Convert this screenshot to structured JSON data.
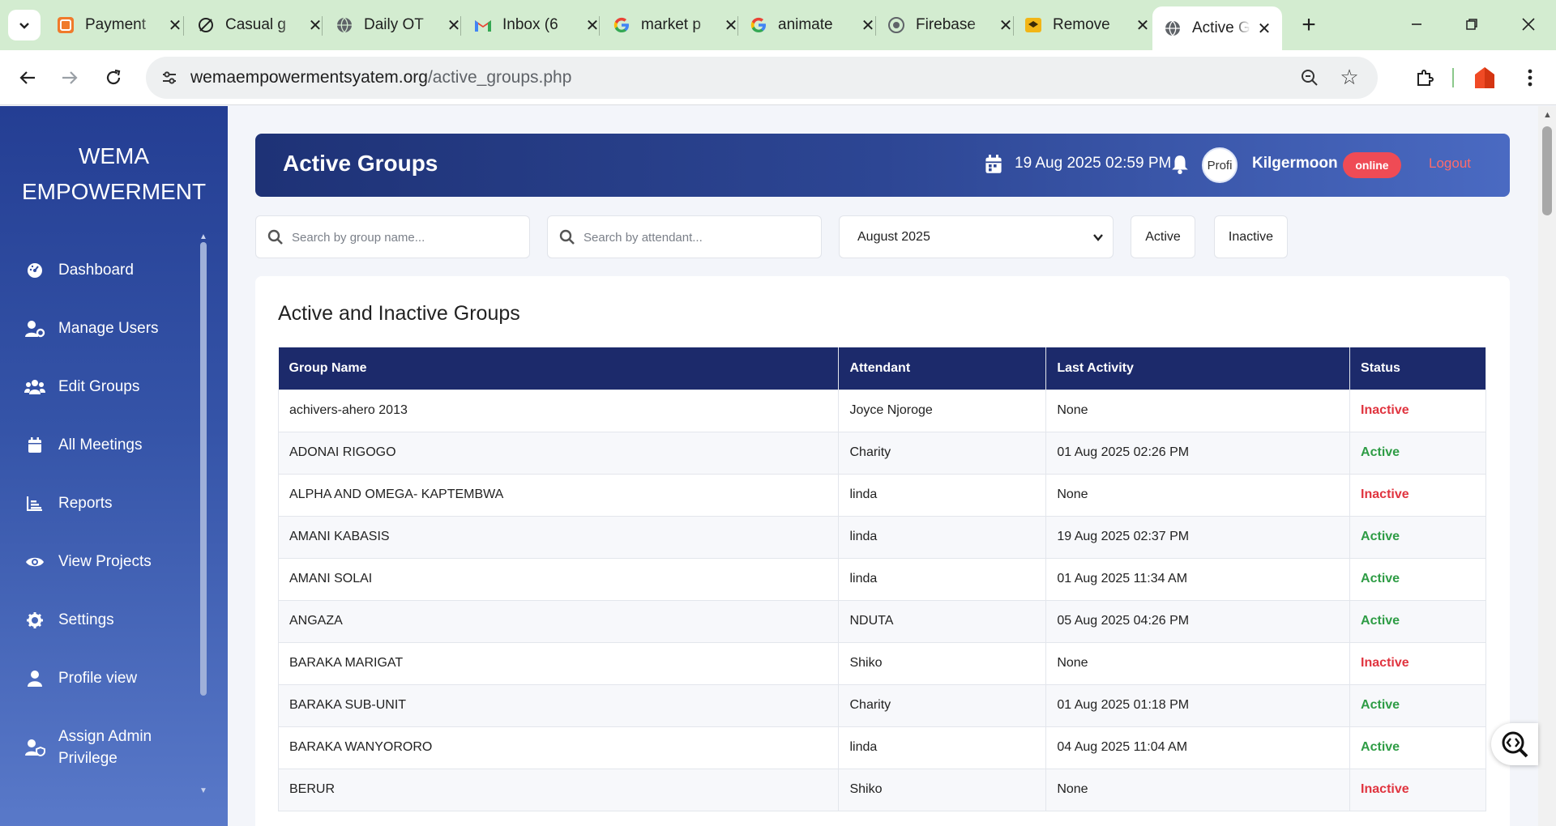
{
  "browser": {
    "tabs": [
      {
        "title": "Payment",
        "icon": "payment-favicon-icon"
      },
      {
        "title": "Casual g",
        "icon": "casual-favicon-icon"
      },
      {
        "title": "Daily OT",
        "icon": "globe-icon"
      },
      {
        "title": "Inbox (6",
        "icon": "gmail-icon"
      },
      {
        "title": "market p",
        "icon": "google-icon"
      },
      {
        "title": "animate",
        "icon": "google-icon"
      },
      {
        "title": "Firebase",
        "icon": "firebase-icon"
      },
      {
        "title": "Remove",
        "icon": "remove-favicon-icon"
      },
      {
        "title": "Active G",
        "icon": "globe-icon",
        "active": true
      }
    ],
    "url_host": "wemaempowermentsyatem.org",
    "url_path": "/active_groups.php"
  },
  "sidebar": {
    "brand_line1": "WEMA",
    "brand_line2": "EMPOWERMENT",
    "items": [
      {
        "label": "Dashboard",
        "icon": "dashboard-gauge-icon"
      },
      {
        "label": "Manage Users",
        "icon": "user-gear-icon"
      },
      {
        "label": "Edit Groups",
        "icon": "users-icon"
      },
      {
        "label": "All Meetings",
        "icon": "calendar-icon"
      },
      {
        "label": "Reports",
        "icon": "chart-bar-icon"
      },
      {
        "label": "View Projects",
        "icon": "eye-icon"
      },
      {
        "label": "Settings",
        "icon": "gear-icon"
      },
      {
        "label": "Profile view",
        "icon": "user-icon"
      },
      {
        "label": "Assign Admin Privilege",
        "icon": "user-shield-icon"
      }
    ]
  },
  "header": {
    "title": "Active Groups",
    "datetime": "19 Aug 2025 02:59 PM",
    "avatar_alt": "Profi",
    "username": "Kilgermoon",
    "status_badge": "online",
    "logout": "Logout"
  },
  "filters": {
    "group_search_placeholder": "Search by group name...",
    "attendant_search_placeholder": "Search by attendant...",
    "month_value": "August 2025",
    "active_label": "Active",
    "inactive_label": "Inactive"
  },
  "table": {
    "title": "Active and Inactive Groups",
    "columns": [
      "Group Name",
      "Attendant",
      "Last Activity",
      "Status"
    ],
    "rows": [
      {
        "group": "achivers-ahero 2013",
        "attendant": "Joyce Njoroge",
        "last_activity": "None",
        "status": "Inactive"
      },
      {
        "group": "ADONAI RIGOGO",
        "attendant": "Charity",
        "last_activity": "01 Aug 2025 02:26 PM",
        "status": "Active"
      },
      {
        "group": "ALPHA AND OMEGA- KAPTEMBWA",
        "attendant": "linda",
        "last_activity": "None",
        "status": "Inactive"
      },
      {
        "group": "AMANI KABASIS",
        "attendant": "linda",
        "last_activity": "19 Aug 2025 02:37 PM",
        "status": "Active"
      },
      {
        "group": "AMANI SOLAI",
        "attendant": "linda",
        "last_activity": "01 Aug 2025 11:34 AM",
        "status": "Active"
      },
      {
        "group": "ANGAZA",
        "attendant": "NDUTA",
        "last_activity": "05 Aug 2025 04:26 PM",
        "status": "Active"
      },
      {
        "group": "BARAKA MARIGAT",
        "attendant": "Shiko",
        "last_activity": "None",
        "status": "Inactive"
      },
      {
        "group": "BARAKA SUB-UNIT",
        "attendant": "Charity",
        "last_activity": "01 Aug 2025 01:18 PM",
        "status": "Active"
      },
      {
        "group": "BARAKA WANYORORO",
        "attendant": "linda",
        "last_activity": "04 Aug 2025 11:04 AM",
        "status": "Active"
      },
      {
        "group": "BERUR",
        "attendant": "Shiko",
        "last_activity": "None",
        "status": "Inactive"
      }
    ]
  },
  "colors": {
    "sidebar_top": "#243e93",
    "header_start": "#1e3276",
    "table_header": "#1c2a6b",
    "status_active": "#2e9c45",
    "status_inactive": "#e0343f",
    "online_badge": "#ef4b55"
  }
}
